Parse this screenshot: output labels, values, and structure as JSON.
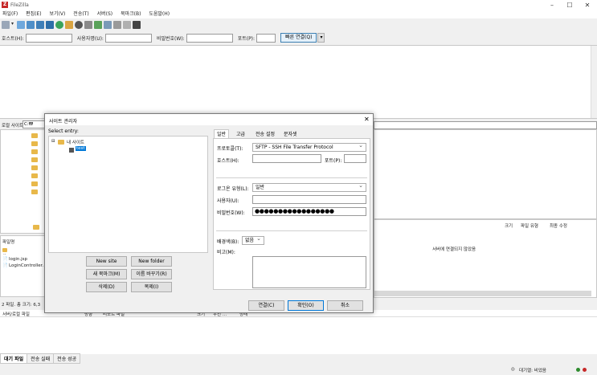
{
  "window": {
    "title": "FileZilla",
    "minimize": "–",
    "maximize": "☐",
    "close": "✕"
  },
  "menu": [
    "파일(F)",
    "편집(E)",
    "보기(V)",
    "전송(T)",
    "서버(S)",
    "북마크(B)",
    "도움말(H)"
  ],
  "quickconnect": {
    "host_label": "호스트(H):",
    "user_label": "사용자명(U):",
    "pass_label": "비밀번호(W):",
    "port_label": "포트(P):",
    "connect_button": "빠른 연결(Q)"
  },
  "local": {
    "site_label": "로컬 사이트:",
    "path": "C:₩",
    "filename_header": "파일명",
    "files": [
      "..",
      "login.jsp",
      "LoginController."
    ],
    "status": "2 파일. 총 크기: 6,3"
  },
  "remote": {
    "col_size": "크기",
    "col_type": "파일 유형",
    "col_modified": "최종 수정",
    "not_connected": "서버에 연결되지 않았음"
  },
  "queue": {
    "col_server": "서버/로컬 파일",
    "col_direction": "방향",
    "col_remote": "리모트 파일",
    "col_size": "크기",
    "col_priority": "우선 ...",
    "col_status": "상태"
  },
  "bottom_tabs": [
    "대기 파일",
    "전송 실패",
    "전송 성공"
  ],
  "statusbar": {
    "queue": "대기열: 비었음"
  },
  "dialog": {
    "title": "사이트 관리자",
    "select_entry": "Select entry:",
    "tree_root": "내 사이트",
    "tree_site": "test",
    "buttons": {
      "new_site": "New site",
      "new_folder": "New folder",
      "new_bookmark": "새 북마크(M)",
      "rename": "이름 바꾸기(R)",
      "delete": "삭제(D)",
      "copy": "복제(I)",
      "connect": "연결(C)",
      "ok": "확인(O)",
      "cancel": "취소"
    },
    "tabs": [
      "일반",
      "고급",
      "전송 설정",
      "문자셋"
    ],
    "protocol_label": "프로토콜(T):",
    "protocol_value": "SFTP - SSH File Transfer Protocol",
    "host_label": "호스트(H):",
    "port_label": "포트(P):",
    "logon_label": "로그온 유형(L):",
    "logon_value": "일반",
    "user_label": "사용자(U):",
    "password_label": "비밀번호(W):",
    "password_value": "●●●●●●●●●●●●●●●●●",
    "background_label": "배경색(B):",
    "background_value": "없음",
    "comments_label": "비고(M):"
  },
  "colors": {
    "accent": "#3c7fb1",
    "logo": "#c62828",
    "folder": "#e8b84a"
  }
}
